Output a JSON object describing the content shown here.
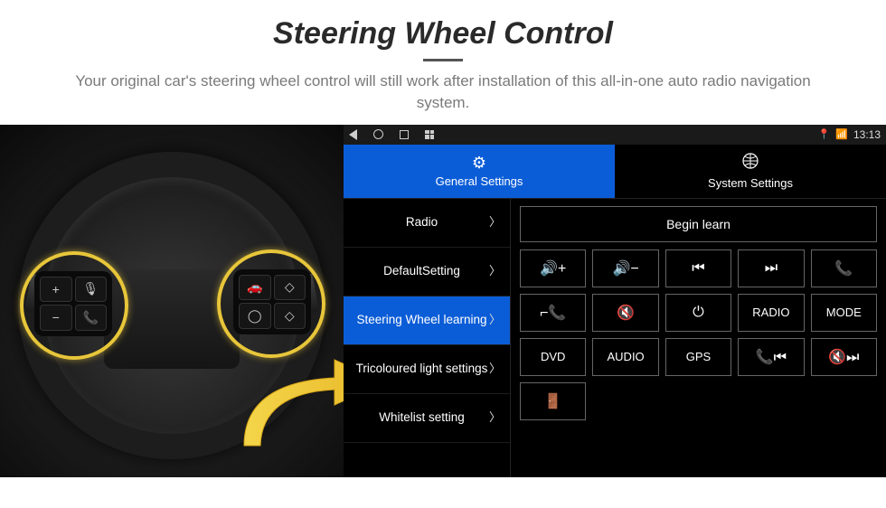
{
  "header": {
    "title": "Steering Wheel Control",
    "subtitle": "Your original car's steering wheel control will still work after installation of this all-in-one auto radio navigation system."
  },
  "wheel_buttons": {
    "left": [
      "+",
      "🎙",
      "−",
      "📞"
    ],
    "right": [
      "🚗",
      "◇",
      "◯",
      "◇"
    ]
  },
  "status": {
    "time": "13:13",
    "gps_icon": "📍",
    "wifi_icon": "▼"
  },
  "tabs": [
    {
      "label": "General Settings",
      "icon": "⚙",
      "active": true
    },
    {
      "label": "System Settings",
      "icon": "🌐",
      "active": false
    }
  ],
  "sidebar": {
    "items": [
      {
        "label": "Radio",
        "active": false
      },
      {
        "label": "DefaultSetting",
        "active": false
      },
      {
        "label": "Steering Wheel learning",
        "active": true
      },
      {
        "label": "Tricoloured light settings",
        "active": false
      },
      {
        "label": "Whitelist setting",
        "active": false
      }
    ]
  },
  "panel": {
    "begin_learn": "Begin learn",
    "buttons": [
      "vol-up",
      "vol-down",
      "prev",
      "next",
      "call",
      "hangup",
      "mute",
      "power",
      "RADIO",
      "MODE",
      "DVD",
      "AUDIO",
      "GPS",
      "call-prev",
      "call-next",
      "car-door"
    ]
  }
}
